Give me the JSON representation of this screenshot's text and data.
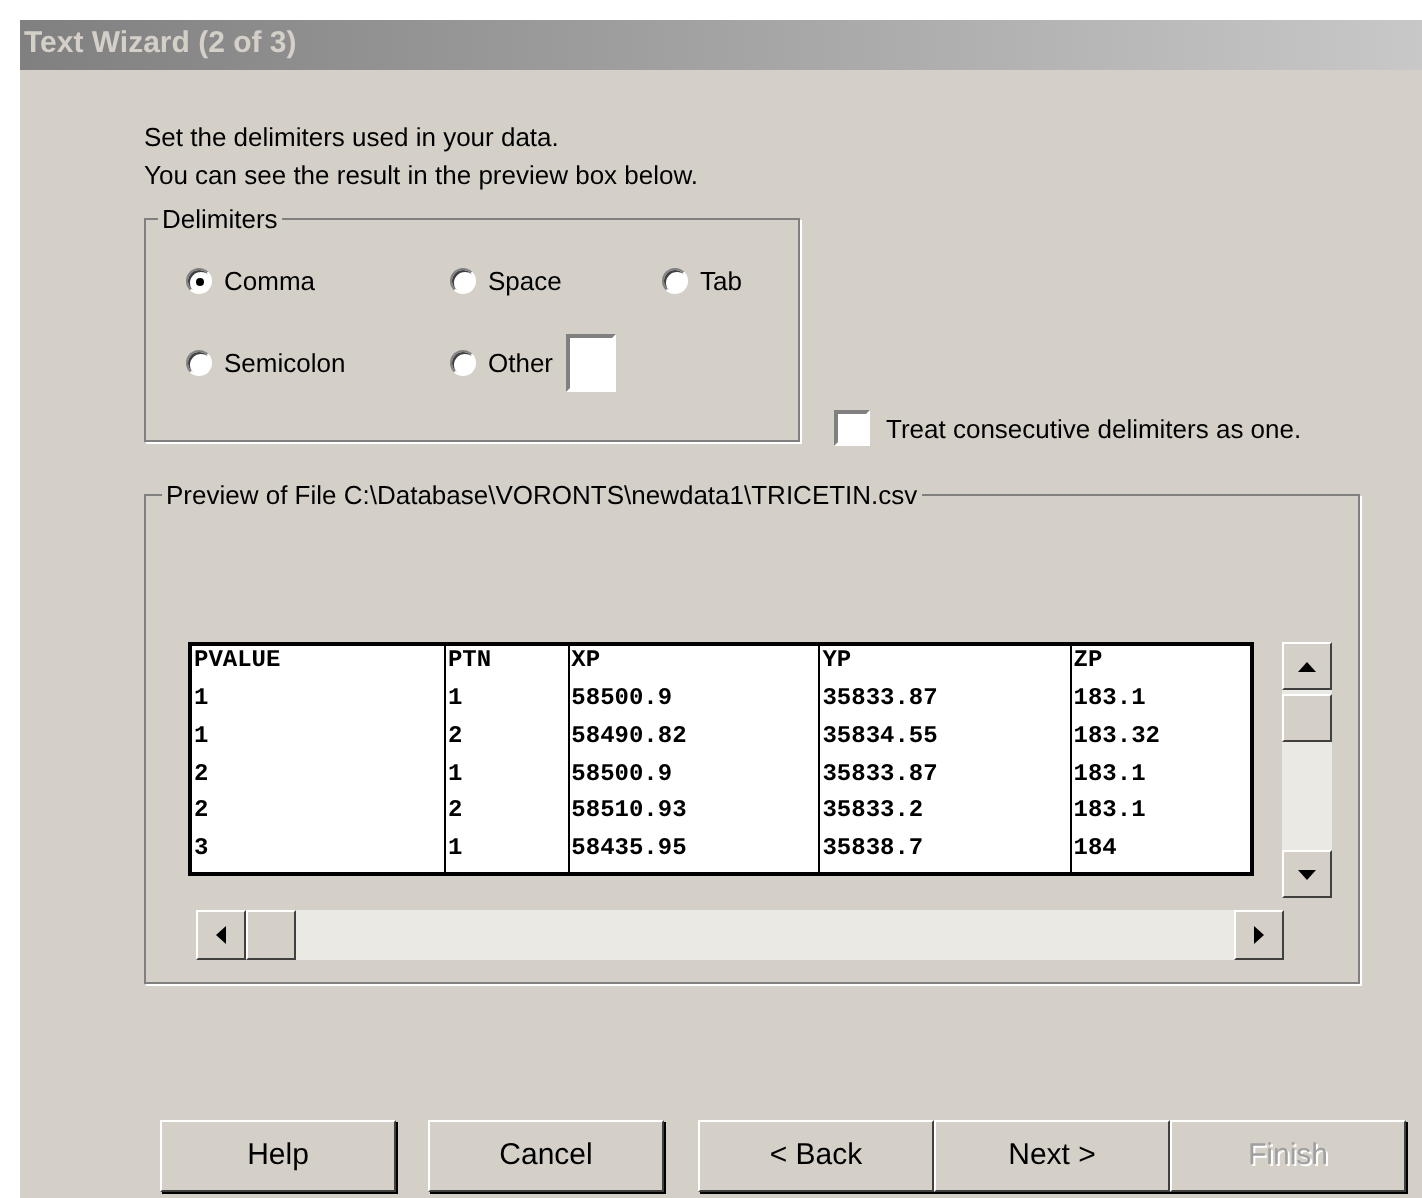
{
  "window": {
    "title": "Text Wizard (2 of 3)"
  },
  "instructions": [
    "Set the delimiters used in your data.",
    "You can see the result in the preview box below."
  ],
  "delimiters": {
    "title": "Delimiters",
    "options": [
      {
        "label": "Comma",
        "selected": true
      },
      {
        "label": "Space",
        "selected": false
      },
      {
        "label": "Tab",
        "selected": false
      },
      {
        "label": "Semicolon",
        "selected": false
      },
      {
        "label": "Other",
        "selected": false,
        "has_field": true
      }
    ]
  },
  "consecutive": {
    "label": "Treat consecutive delimiters as one.",
    "checked": false
  },
  "preview": {
    "title": "Preview of File C:\\Database\\VORONTS\\newdata1\\TRICETIN.csv",
    "columns": [
      "PVALUE",
      "PTN",
      "XP",
      "YP",
      "ZP"
    ],
    "rows": [
      [
        "1",
        "1",
        "58500.9",
        "35833.87",
        "183.1"
      ],
      [
        "1",
        "2",
        "58490.82",
        "35834.55",
        "183.32"
      ],
      [
        "2",
        "1",
        "58500.9",
        "35833.87",
        "183.1"
      ],
      [
        "2",
        "2",
        "58510.93",
        "35833.2",
        "183.1"
      ],
      [
        "3",
        "1",
        "58435.95",
        "35838.7",
        "184"
      ]
    ]
  },
  "buttons": [
    {
      "label": "Help",
      "disabled": false
    },
    {
      "label": "Cancel",
      "disabled": false
    },
    {
      "label": "< Back",
      "disabled": false
    },
    {
      "label": "Next >",
      "disabled": false
    },
    {
      "label": "Finish",
      "disabled": true
    }
  ]
}
